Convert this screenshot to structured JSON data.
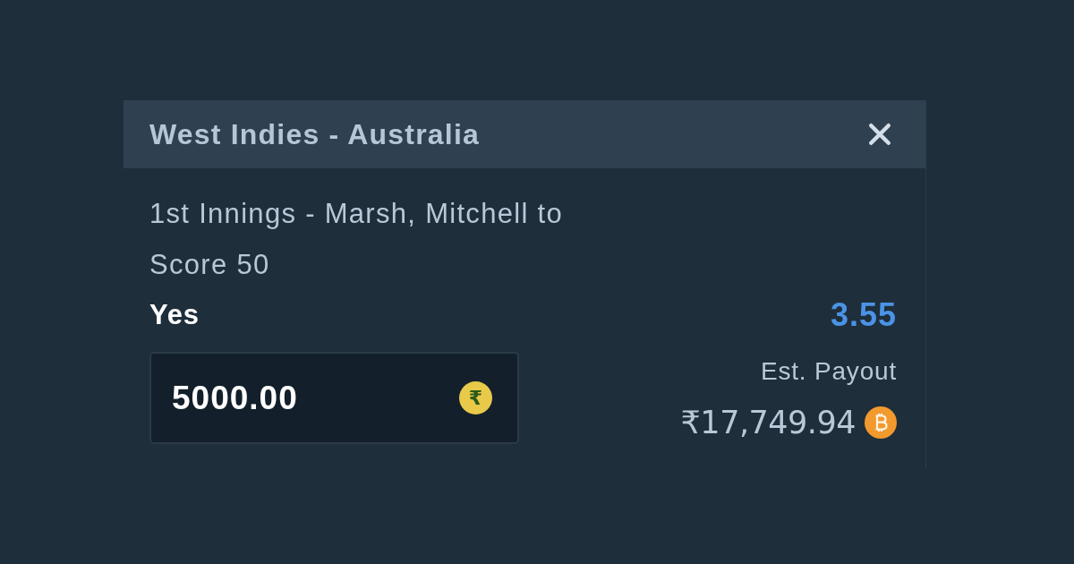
{
  "dialog": {
    "title": "West Indies - Australia"
  },
  "bet": {
    "market": "1st Innings - Marsh, Mitchell to Score 50",
    "selection": "Yes",
    "odds": "3.55"
  },
  "stake": {
    "value": "5000.00",
    "currency_symbol": "₹"
  },
  "payout": {
    "label": "Est. Payout",
    "amount": "₹17,749.94"
  }
}
